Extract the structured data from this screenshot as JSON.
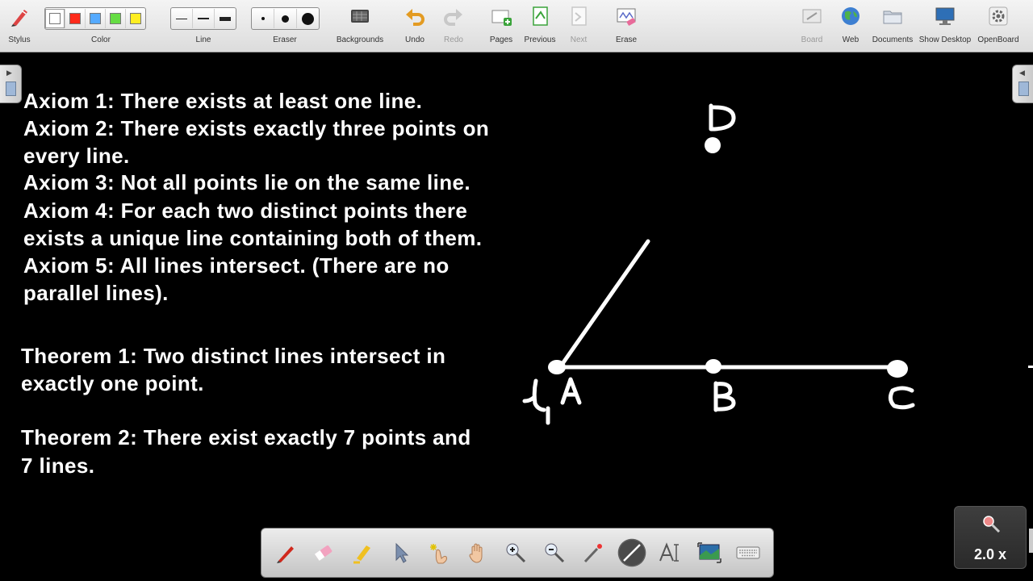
{
  "toolbar": {
    "stylus": "Stylus",
    "color": "Color",
    "line": "Line",
    "eraser": "Eraser",
    "backgrounds": "Backgrounds",
    "undo": "Undo",
    "redo": "Redo",
    "pages": "Pages",
    "previous": "Previous",
    "next": "Next",
    "erase": "Erase",
    "board": "Board",
    "web": "Web",
    "documents": "Documents",
    "show_desktop": "Show Desktop",
    "openboard": "OpenBoard"
  },
  "colors": {
    "swatches": [
      "#ffffff",
      "#ff2a1a",
      "#55aaff",
      "#66dd44",
      "#ffee22"
    ],
    "selected_swatch": "#ffffff",
    "board_background": "#000000",
    "ink": "#ffffff"
  },
  "board": {
    "axioms": [
      "Axiom 1: There exists at least one line.",
      "Axiom 2: There exists exactly three points on",
      "every line.",
      "Axiom 3: Not all points lie on the same line.",
      "Axiom 4: For each two distinct points there",
      "exists a unique line containing both of them.",
      "Axiom 5: All lines intersect. (There are no",
      "parallel lines)."
    ],
    "theorem1": [
      "Theorem 1: Two distinct lines intersect in",
      "exactly one point."
    ],
    "theorem2": [
      "Theorem 2: There exist exactly 7 points and",
      "7 lines."
    ]
  },
  "drawing": {
    "points": [
      "A",
      "B",
      "C",
      "D"
    ],
    "line_label": "l1"
  },
  "dock": {
    "tools": [
      "pen-icon",
      "eraser-icon",
      "highlighter-icon",
      "pointer-icon",
      "interact-icon",
      "hand-icon",
      "zoom-in-icon",
      "zoom-out-icon",
      "laser-pointer-icon",
      "line-tool-icon",
      "text-tool-icon",
      "capture-icon",
      "keyboard-icon"
    ],
    "selected": "line-tool-icon"
  },
  "zoom": {
    "label": "2.0 x"
  }
}
